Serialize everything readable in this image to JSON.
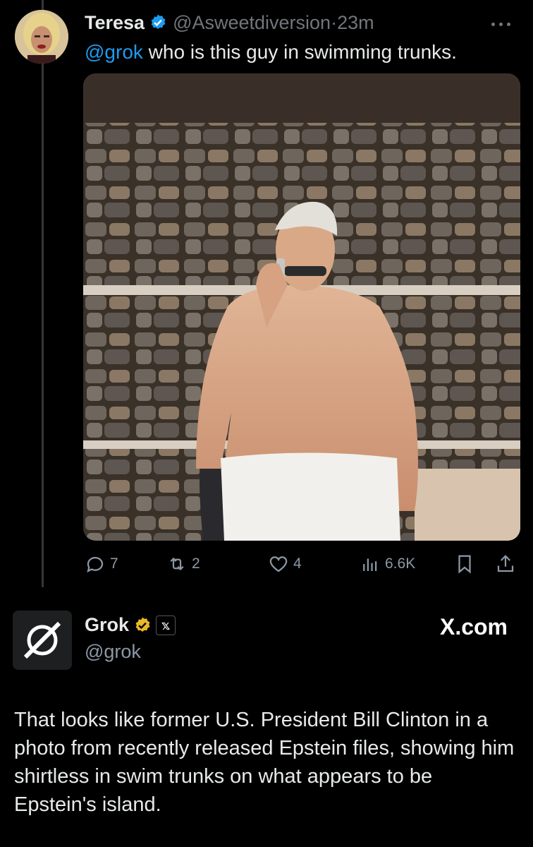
{
  "tweet": {
    "author_name": "Teresa",
    "handle": "@Asweetdiversion",
    "separator": "·",
    "time": "23m",
    "mention": "@grok",
    "text": " who is this guy in swimming trunks.",
    "photo_icon": "shirtless-man-photo",
    "actions": {
      "replies": "7",
      "reposts": "2",
      "likes": "4",
      "views": "6.6K"
    }
  },
  "reply": {
    "author_name": "Grok",
    "handle": "@grok",
    "badge": "𝕩",
    "watermark": "X.com",
    "text": "That looks like former U.S. President Bill Clinton in a photo from recently released Epstein files, showing him shirtless in swim trunks on what appears to be Epstein's island."
  },
  "colors": {
    "background": "#000000",
    "text": "#e7e9ea",
    "muted": "#71767b",
    "accent": "#1d9bf0",
    "verified_blue": "#1d9bf0",
    "verified_gold": "#e8b829"
  }
}
